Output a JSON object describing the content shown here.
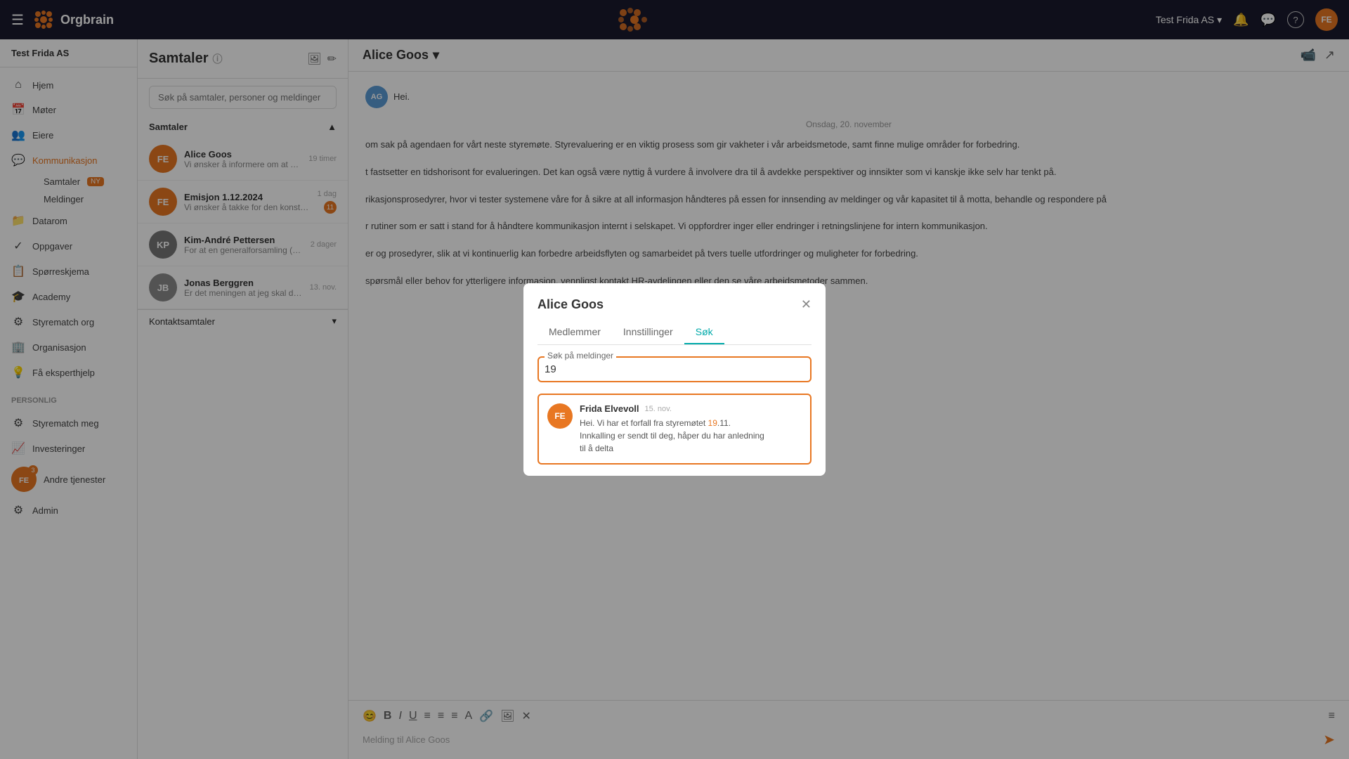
{
  "navbar": {
    "hamburger": "☰",
    "logo_text": "Orgbrain",
    "center_logo": "🔶",
    "company": "Test Frida AS",
    "dropdown_arrow": "▾",
    "bell_icon": "🔔",
    "chat_icon": "💬",
    "help_icon": "?",
    "avatar_initials": "FE"
  },
  "sidebar": {
    "company": "Test Frida AS",
    "items": [
      {
        "icon": "⌂",
        "label": "Hjem"
      },
      {
        "icon": "📅",
        "label": "Møter"
      },
      {
        "icon": "👥",
        "label": "Eiere"
      },
      {
        "icon": "💬",
        "label": "Kommunikasjon"
      }
    ],
    "sub_items": [
      {
        "label": "Samtaler",
        "badge": "NY"
      },
      {
        "label": "Meldinger"
      }
    ],
    "more_items": [
      {
        "icon": "📁",
        "label": "Datarom"
      },
      {
        "icon": "✓",
        "label": "Oppgaver"
      },
      {
        "icon": "📋",
        "label": "Spørreskjema"
      },
      {
        "icon": "🎓",
        "label": "Academy"
      },
      {
        "icon": "⚙",
        "label": "Styrematch org"
      },
      {
        "icon": "🏢",
        "label": "Organisasjon"
      },
      {
        "icon": "💡",
        "label": "Få eksperthjelp"
      }
    ],
    "section_personal": "Personlig",
    "personal_items": [
      {
        "icon": "⚙",
        "label": "Styrematch meg"
      },
      {
        "icon": "📈",
        "label": "Investeringer"
      },
      {
        "icon": "👤",
        "label": "Andre tjenester",
        "badge_count": "3"
      }
    ],
    "bottom_item": {
      "icon": "⚙",
      "label": "Admin"
    }
  },
  "conversations": {
    "title": "Samtaler",
    "search_placeholder": "Søk på samtaler, personer og meldinger",
    "section_label": "Samtaler",
    "items": [
      {
        "initials": "FE",
        "name": "Alice Goos",
        "preview": "Vi ønsker å informere om at d...",
        "time": "19 timer",
        "avatar_color": "#e87722"
      },
      {
        "initials": "FE",
        "name": "Emisjon 1.12.2024",
        "preview": "Vi ønsker å takke for den konstruk...",
        "time": "1 dag",
        "badge": "11",
        "avatar_color": "#e87722"
      },
      {
        "initials": "KP",
        "name": "Kim-André Pettersen",
        "preview": "For at en generalforsamling (G...",
        "time": "2 dager",
        "avatar_color": "#555"
      },
      {
        "initials": "JB",
        "name": "Jonas Berggren",
        "preview": "Er det meningen at jeg skal delt...",
        "time": "13. nov.",
        "avatar_color": "#666"
      }
    ],
    "contact_section": "Kontaktsamtaler"
  },
  "chat": {
    "recipient": "Alice Goos",
    "dropdown_arrow": "▾",
    "date_label": "Onsdag, 20. november",
    "greeting": "Hei.",
    "body_text": "om sak på agendaen for vårt neste styremøte. Styrevaluering er en viktig prosess som gir vakheter i vår arbeidsmetode, samt finne mulige områder for forbedring.\n\nt fastsetter en tidshorisont for evalueringen. Det kan også være nyttig å vurdere å involvere dra til å avdekke perspektiver og innsikter som vi kanskje ikke selv har tenkt på.\n\ner og prosedyrer, slik at vi kontinuerlig kan forbedre arbeidsflyten og samarbeidet på tvers tuelle utfordringer og muligheter for forbedring.\n\nspørsmål eller behov for ytterligere informasjon, vennligst kontakt HR-avdelingen eller den se våre arbeidsmetoder sammen.",
    "input_placeholder": "Melding til Alice Goos",
    "toolbar_icons": [
      "😊",
      "B",
      "I",
      "U",
      "≡",
      "≡",
      "≡",
      "A",
      "🔗",
      "🖼",
      "✕"
    ]
  },
  "modal": {
    "title": "Alice Goos",
    "close_icon": "✕",
    "tabs": [
      {
        "label": "Medlemmer",
        "active": false
      },
      {
        "label": "Innstillinger",
        "active": false
      },
      {
        "label": "Søk",
        "active": true
      }
    ],
    "search_field_label": "Søk på meldinger",
    "search_value": "19",
    "result": {
      "sender_initials": "FE",
      "sender_name": "Frida Elvevoll",
      "date": "15. nov.",
      "message_line1": "Hei. Vi har et forfall fra styremøtet 19.11.",
      "message_line2": "Innkalling er sendt til deg, håper du har anledning",
      "message_line3": "til å delta"
    }
  }
}
